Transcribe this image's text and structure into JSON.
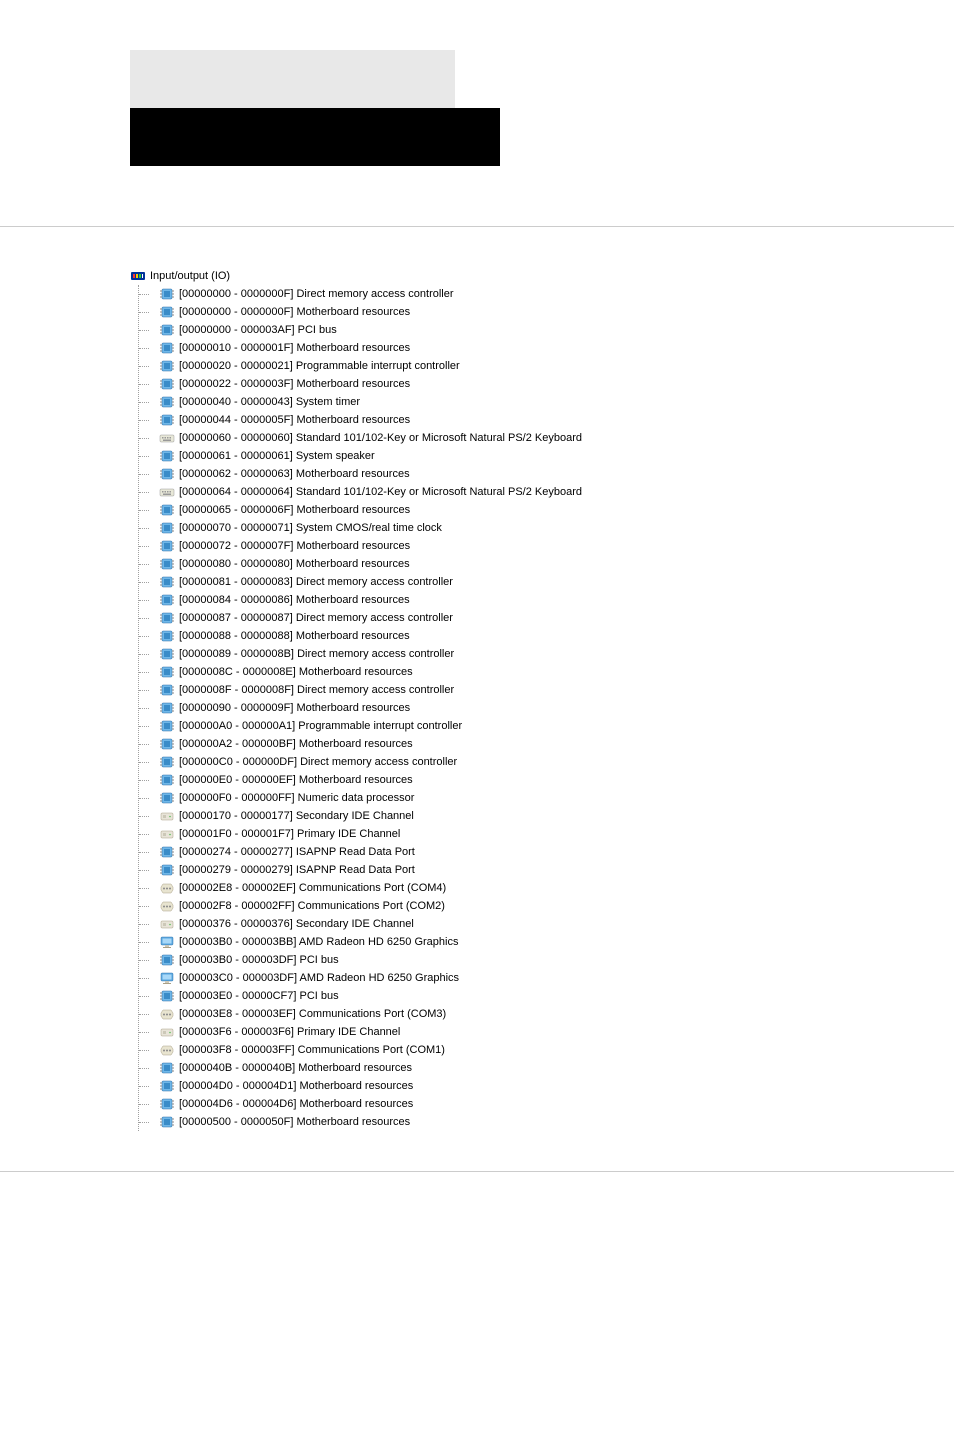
{
  "root": {
    "label": "Input/output (IO)",
    "icon": "io-root-icon"
  },
  "items": [
    {
      "range": "[00000000 - 0000000F]",
      "label": "Direct memory access controller",
      "icon": "device-icon"
    },
    {
      "range": "[00000000 - 0000000F]",
      "label": "Motherboard resources",
      "icon": "device-icon"
    },
    {
      "range": "[00000000 - 000003AF]",
      "label": "PCI bus",
      "icon": "device-icon"
    },
    {
      "range": "[00000010 - 0000001F]",
      "label": "Motherboard resources",
      "icon": "device-icon"
    },
    {
      "range": "[00000020 - 00000021]",
      "label": "Programmable interrupt controller",
      "icon": "device-icon"
    },
    {
      "range": "[00000022 - 0000003F]",
      "label": "Motherboard resources",
      "icon": "device-icon"
    },
    {
      "range": "[00000040 - 00000043]",
      "label": "System timer",
      "icon": "device-icon"
    },
    {
      "range": "[00000044 - 0000005F]",
      "label": "Motherboard resources",
      "icon": "device-icon"
    },
    {
      "range": "[00000060 - 00000060]",
      "label": "Standard 101/102-Key or Microsoft Natural PS/2 Keyboard",
      "icon": "keyboard-icon"
    },
    {
      "range": "[00000061 - 00000061]",
      "label": "System speaker",
      "icon": "device-icon"
    },
    {
      "range": "[00000062 - 00000063]",
      "label": "Motherboard resources",
      "icon": "device-icon"
    },
    {
      "range": "[00000064 - 00000064]",
      "label": "Standard 101/102-Key or Microsoft Natural PS/2 Keyboard",
      "icon": "keyboard-icon"
    },
    {
      "range": "[00000065 - 0000006F]",
      "label": "Motherboard resources",
      "icon": "device-icon"
    },
    {
      "range": "[00000070 - 00000071]",
      "label": "System CMOS/real time clock",
      "icon": "device-icon"
    },
    {
      "range": "[00000072 - 0000007F]",
      "label": "Motherboard resources",
      "icon": "device-icon"
    },
    {
      "range": "[00000080 - 00000080]",
      "label": "Motherboard resources",
      "icon": "device-icon"
    },
    {
      "range": "[00000081 - 00000083]",
      "label": "Direct memory access controller",
      "icon": "device-icon"
    },
    {
      "range": "[00000084 - 00000086]",
      "label": "Motherboard resources",
      "icon": "device-icon"
    },
    {
      "range": "[00000087 - 00000087]",
      "label": "Direct memory access controller",
      "icon": "device-icon"
    },
    {
      "range": "[00000088 - 00000088]",
      "label": "Motherboard resources",
      "icon": "device-icon"
    },
    {
      "range": "[00000089 - 0000008B]",
      "label": "Direct memory access controller",
      "icon": "device-icon"
    },
    {
      "range": "[0000008C - 0000008E]",
      "label": "Motherboard resources",
      "icon": "device-icon"
    },
    {
      "range": "[0000008F - 0000008F]",
      "label": "Direct memory access controller",
      "icon": "device-icon"
    },
    {
      "range": "[00000090 - 0000009F]",
      "label": "Motherboard resources",
      "icon": "device-icon"
    },
    {
      "range": "[000000A0 - 000000A1]",
      "label": "Programmable interrupt controller",
      "icon": "device-icon"
    },
    {
      "range": "[000000A2 - 000000BF]",
      "label": "Motherboard resources",
      "icon": "device-icon"
    },
    {
      "range": "[000000C0 - 000000DF]",
      "label": "Direct memory access controller",
      "icon": "device-icon"
    },
    {
      "range": "[000000E0 - 000000EF]",
      "label": "Motherboard resources",
      "icon": "device-icon"
    },
    {
      "range": "[000000F0 - 000000FF]",
      "label": "Numeric data processor",
      "icon": "device-icon"
    },
    {
      "range": "[00000170 - 00000177]",
      "label": "Secondary IDE Channel",
      "icon": "disk-icon"
    },
    {
      "range": "[000001F0 - 000001F7]",
      "label": "Primary IDE Channel",
      "icon": "disk-icon"
    },
    {
      "range": "[00000274 - 00000277]",
      "label": "ISAPNP Read Data Port",
      "icon": "device-icon"
    },
    {
      "range": "[00000279 - 00000279]",
      "label": "ISAPNP Read Data Port",
      "icon": "device-icon"
    },
    {
      "range": "[000002E8 - 000002EF]",
      "label": "Communications Port (COM4)",
      "icon": "port-icon"
    },
    {
      "range": "[000002F8 - 000002FF]",
      "label": "Communications Port (COM2)",
      "icon": "port-icon"
    },
    {
      "range": "[00000376 - 00000376]",
      "label": "Secondary IDE Channel",
      "icon": "disk-icon"
    },
    {
      "range": "[000003B0 - 000003BB]",
      "label": "AMD Radeon HD 6250 Graphics",
      "icon": "display-icon"
    },
    {
      "range": "[000003B0 - 000003DF]",
      "label": "PCI bus",
      "icon": "device-icon"
    },
    {
      "range": "[000003C0 - 000003DF]",
      "label": "AMD Radeon HD 6250 Graphics",
      "icon": "display-icon"
    },
    {
      "range": "[000003E0 - 00000CF7]",
      "label": "PCI bus",
      "icon": "device-icon"
    },
    {
      "range": "[000003E8 - 000003EF]",
      "label": "Communications Port (COM3)",
      "icon": "port-icon"
    },
    {
      "range": "[000003F6 - 000003F6]",
      "label": "Primary IDE Channel",
      "icon": "disk-icon"
    },
    {
      "range": "[000003F8 - 000003FF]",
      "label": "Communications Port (COM1)",
      "icon": "port-icon"
    },
    {
      "range": "[0000040B - 0000040B]",
      "label": "Motherboard resources",
      "icon": "device-icon"
    },
    {
      "range": "[000004D0 - 000004D1]",
      "label": "Motherboard resources",
      "icon": "device-icon"
    },
    {
      "range": "[000004D6 - 000004D6]",
      "label": "Motherboard resources",
      "icon": "device-icon"
    },
    {
      "range": "[00000500 - 0000050F]",
      "label": "Motherboard resources",
      "icon": "device-icon"
    }
  ],
  "icons": {
    "io-root-icon": "io",
    "device-icon": "chip",
    "keyboard-icon": "keyboard",
    "disk-icon": "disk",
    "port-icon": "port",
    "display-icon": "display"
  }
}
